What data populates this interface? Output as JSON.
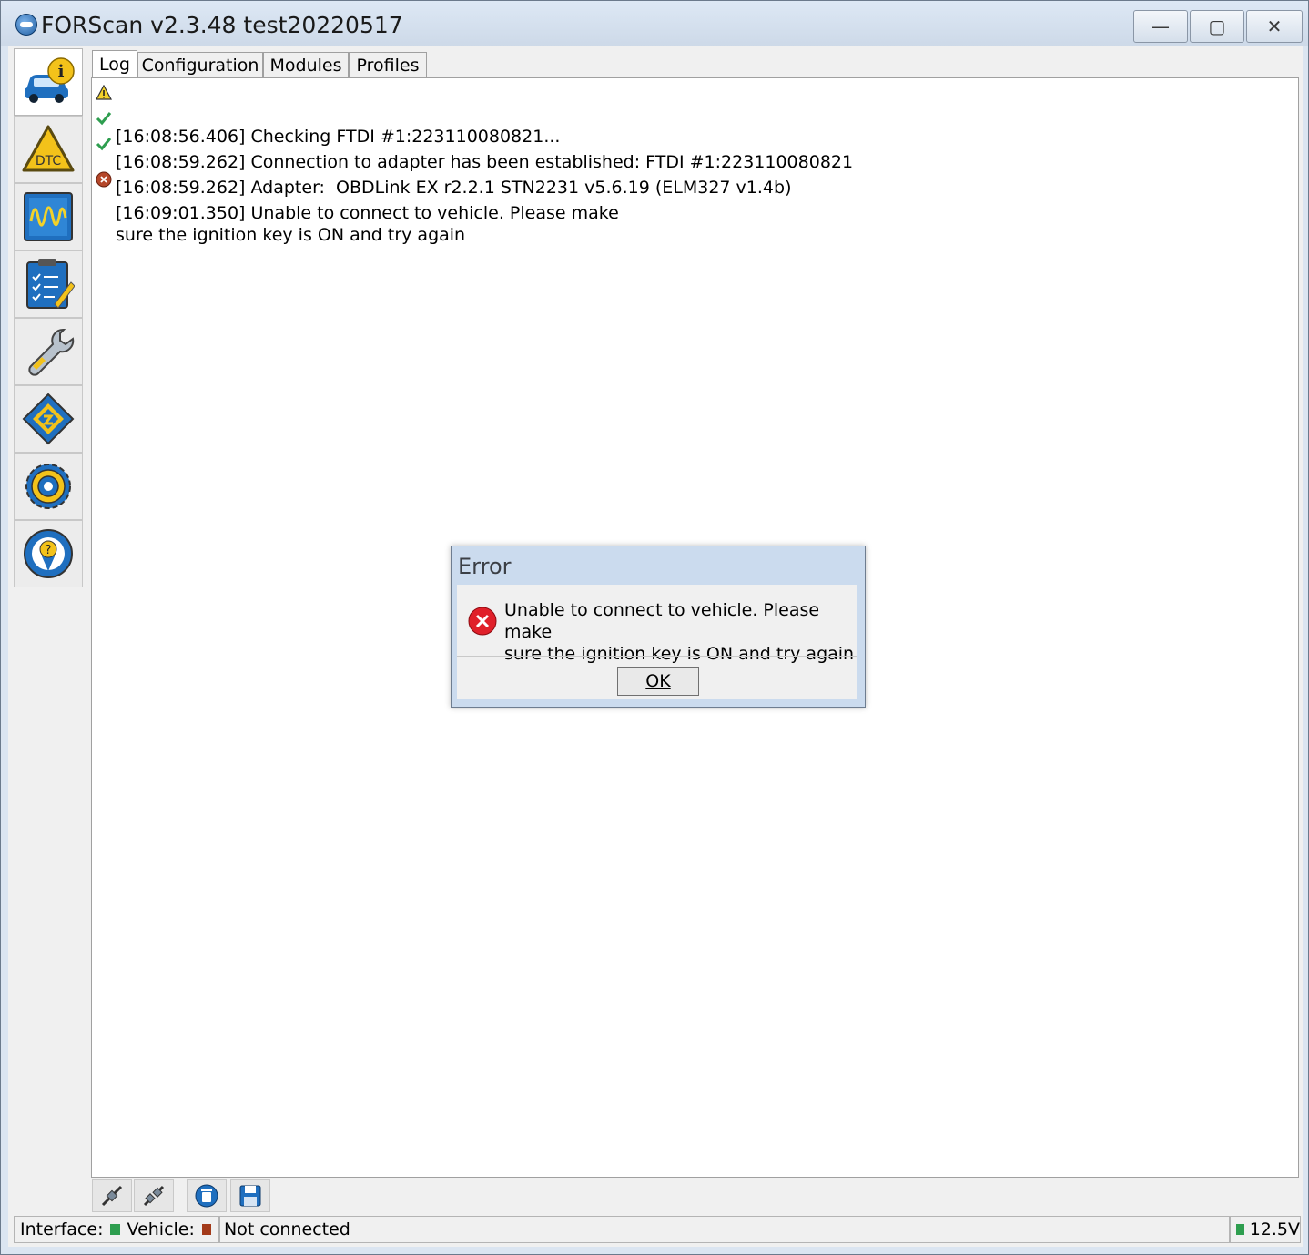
{
  "window": {
    "title": "FORScan v2.3.48 test20220517",
    "minimize_glyph": "—",
    "maximize_glyph": "▢",
    "close_glyph": "✕"
  },
  "sidebar": {
    "items": [
      {
        "name": "vehicle-info",
        "icon": "car-info-icon",
        "active": true
      },
      {
        "name": "dtc",
        "icon": "dtc-warning-icon",
        "label": "DTC"
      },
      {
        "name": "oscilloscope",
        "icon": "oscilloscope-icon"
      },
      {
        "name": "tests",
        "icon": "checklist-icon"
      },
      {
        "name": "service",
        "icon": "wrench-icon"
      },
      {
        "name": "configuration",
        "icon": "chip-icon"
      },
      {
        "name": "settings",
        "icon": "gear-icon"
      },
      {
        "name": "help",
        "icon": "help-icon"
      }
    ]
  },
  "tabs": [
    {
      "label": "Log",
      "active": true
    },
    {
      "label": "Configuration"
    },
    {
      "label": "Modules"
    },
    {
      "label": "Profiles"
    }
  ],
  "log": [
    {
      "level": "warning",
      "icon": "warning-icon",
      "text": "[16:08:56.406] Checking FTDI #1:223110080821..."
    },
    {
      "level": "success",
      "icon": "checkmark-icon",
      "text": "[16:08:59.262] Connection to adapter has been established: FTDI #1:223110080821"
    },
    {
      "level": "success",
      "icon": "checkmark-icon",
      "text": "[16:08:59.262] Adapter:  OBDLink EX r2.2.1 STN2231 v5.6.19 (ELM327 v1.4b)"
    },
    {
      "level": "error",
      "icon": "error-icon",
      "text": "[16:09:01.350] Unable to connect to vehicle. Please make\nsure the ignition key is ON and try again"
    }
  ],
  "toolbar": [
    {
      "name": "connect",
      "icon": "connect-plug-icon"
    },
    {
      "name": "disconnect",
      "icon": "disconnect-plug-icon"
    },
    {
      "name": "clear-log",
      "icon": "trash-icon"
    },
    {
      "name": "save-log",
      "icon": "save-icon"
    }
  ],
  "status": {
    "interface_label": "Interface:",
    "vehicle_label": "Vehicle:",
    "connection_text": "Not connected",
    "voltage": "12.5V",
    "interface_led_color": "#2e9e4f",
    "vehicle_led_color": "#a33a1a",
    "voltage_led_color": "#2e9e4f"
  },
  "dialog": {
    "title": "Error",
    "message_line1": "Unable to connect to vehicle. Please make",
    "message_line2": "sure the ignition key is ON and try again",
    "ok_label": "OK",
    "icon": "error-icon"
  }
}
